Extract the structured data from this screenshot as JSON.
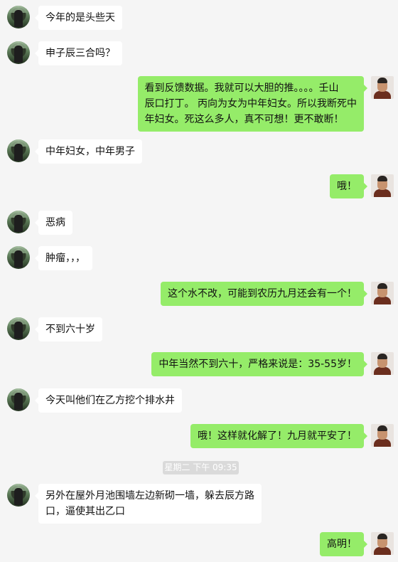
{
  "messages": [
    {
      "side": "left",
      "text": "今年的是头些天"
    },
    {
      "side": "left",
      "text": "申子辰三合吗？"
    },
    {
      "side": "right",
      "lines": [
        "看到反馈数据。我就可以大胆的推。。。。壬山",
        "辰口打丁。 丙向为女为中年妇女。所以我断死中",
        "年妇女。死这么多人，真不可想！更不敢断！"
      ]
    },
    {
      "side": "left",
      "text": "中年妇女，中年男子"
    },
    {
      "side": "right",
      "text": "哦！"
    },
    {
      "side": "left",
      "text": "恶病"
    },
    {
      "side": "left",
      "text": "肿瘤，，，"
    },
    {
      "side": "right",
      "text": "这个水不改，可能到农历九月还会有一个！"
    },
    {
      "side": "left",
      "text": "不到六十岁"
    },
    {
      "side": "right",
      "text": "中年当然不到六十，严格来说是：35-55岁！"
    },
    {
      "side": "left",
      "text": "今天叫他们在乙方挖个排水井"
    },
    {
      "side": "right",
      "text": "哦！这样就化解了！九月就平安了！"
    },
    {
      "side": "left",
      "lines": [
        "另外在屋外月池围墙左边新砌一墙，躲去辰方路",
        "口，逼使其出乙口"
      ]
    },
    {
      "side": "right",
      "text": "高明！"
    }
  ],
  "timestamp": "星期二 下午 09:35"
}
